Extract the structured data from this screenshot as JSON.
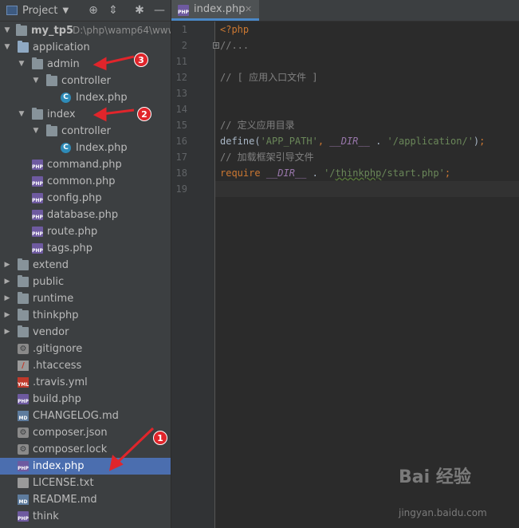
{
  "toolbar": {
    "title": "Project"
  },
  "tree": {
    "root_name": "my_tp5",
    "root_path": "D:\\php\\wamp64\\www",
    "items": [
      {
        "label": "application",
        "type": "folder-blue",
        "depth": 1,
        "arrow": "open"
      },
      {
        "label": "admin",
        "type": "folder",
        "depth": 2,
        "arrow": "open"
      },
      {
        "label": "controller",
        "type": "folder",
        "depth": 3,
        "arrow": "open"
      },
      {
        "label": "Index.php",
        "type": "class",
        "depth": 4,
        "arrow": ""
      },
      {
        "label": "index",
        "type": "folder",
        "depth": 2,
        "arrow": "open"
      },
      {
        "label": "controller",
        "type": "folder",
        "depth": 3,
        "arrow": "open"
      },
      {
        "label": "Index.php",
        "type": "class",
        "depth": 4,
        "arrow": ""
      },
      {
        "label": "command.php",
        "type": "php",
        "depth": 2,
        "arrow": ""
      },
      {
        "label": "common.php",
        "type": "php",
        "depth": 2,
        "arrow": ""
      },
      {
        "label": "config.php",
        "type": "php",
        "depth": 2,
        "arrow": ""
      },
      {
        "label": "database.php",
        "type": "php",
        "depth": 2,
        "arrow": ""
      },
      {
        "label": "route.php",
        "type": "php",
        "depth": 2,
        "arrow": ""
      },
      {
        "label": "tags.php",
        "type": "php",
        "depth": 2,
        "arrow": ""
      },
      {
        "label": "extend",
        "type": "folder",
        "depth": 1,
        "arrow": "closed"
      },
      {
        "label": "public",
        "type": "folder",
        "depth": 1,
        "arrow": "closed"
      },
      {
        "label": "runtime",
        "type": "folder",
        "depth": 1,
        "arrow": "closed"
      },
      {
        "label": "thinkphp",
        "type": "folder",
        "depth": 1,
        "arrow": "closed"
      },
      {
        "label": "vendor",
        "type": "folder",
        "depth": 1,
        "arrow": "closed"
      },
      {
        "label": ".gitignore",
        "type": "gear",
        "depth": 1,
        "arrow": ""
      },
      {
        "label": ".htaccess",
        "type": "htaccess",
        "depth": 1,
        "arrow": ""
      },
      {
        "label": ".travis.yml",
        "type": "yml",
        "depth": 1,
        "arrow": ""
      },
      {
        "label": "build.php",
        "type": "php",
        "depth": 1,
        "arrow": ""
      },
      {
        "label": "CHANGELOG.md",
        "type": "md",
        "depth": 1,
        "arrow": ""
      },
      {
        "label": "composer.json",
        "type": "gear",
        "depth": 1,
        "arrow": ""
      },
      {
        "label": "composer.lock",
        "type": "gear",
        "depth": 1,
        "arrow": ""
      },
      {
        "label": "index.php",
        "type": "php",
        "depth": 1,
        "arrow": "",
        "selected": true
      },
      {
        "label": "LICENSE.txt",
        "type": "txt",
        "depth": 1,
        "arrow": ""
      },
      {
        "label": "README.md",
        "type": "md",
        "depth": 1,
        "arrow": ""
      },
      {
        "label": "think",
        "type": "php",
        "depth": 1,
        "arrow": ""
      }
    ]
  },
  "editor": {
    "tab_label": "index.php",
    "lines": [
      {
        "n": "1",
        "code": "<?php"
      },
      {
        "n": "2",
        "code": "//..."
      },
      {
        "n": "11",
        "code": ""
      },
      {
        "n": "12",
        "code": "// [ 应用入口文件 ]"
      },
      {
        "n": "13",
        "code": ""
      },
      {
        "n": "14",
        "code": ""
      },
      {
        "n": "15",
        "code": "// 定义应用目录"
      },
      {
        "n": "16",
        "code": "define('APP_PATH', __DIR__ . '/application/');"
      },
      {
        "n": "17",
        "code": "// 加载框架引导文件"
      },
      {
        "n": "18",
        "code": "require __DIR__ . '/thinkphp/start.php';"
      },
      {
        "n": "19",
        "code": ""
      }
    ]
  },
  "badges": [
    "3",
    "2",
    "1"
  ],
  "watermark": {
    "brand": "Bai 经验",
    "site": "jingyan.baidu.com"
  },
  "colors": {
    "selection": "#4b6eaf",
    "keyword": "#cc7832",
    "string": "#6a8759",
    "comment": "#808080",
    "badge": "#e0252b"
  }
}
